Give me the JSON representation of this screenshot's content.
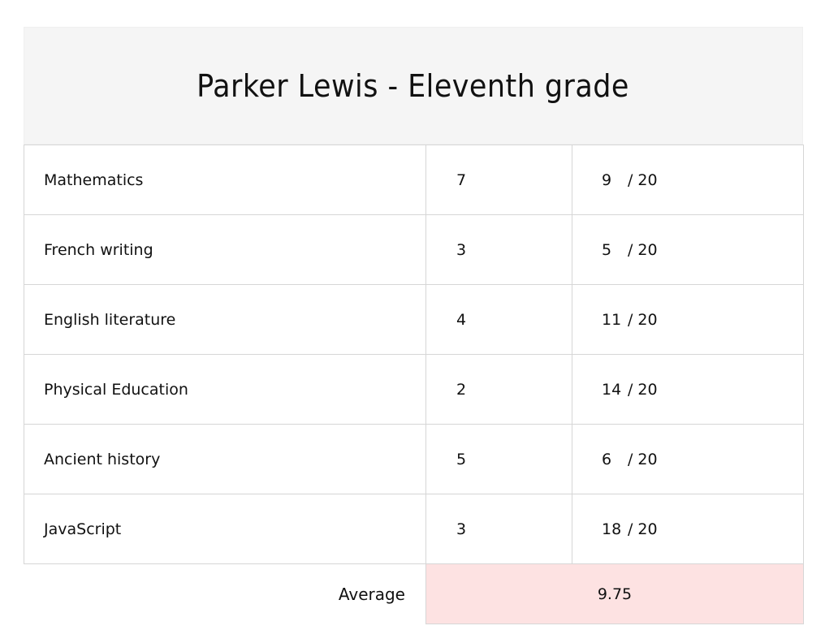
{
  "title": "Parker Lewis - Eleventh grade",
  "rows": [
    {
      "subject": "Mathematics",
      "coefficient": "7",
      "grade": "9",
      "out_of": "20"
    },
    {
      "subject": "French writing",
      "coefficient": "3",
      "grade": "5",
      "out_of": "20"
    },
    {
      "subject": "English literature",
      "coefficient": "4",
      "grade": "11",
      "out_of": "20"
    },
    {
      "subject": "Physical Education",
      "coefficient": "2",
      "grade": "14",
      "out_of": "20"
    },
    {
      "subject": "Ancient history",
      "coefficient": "5",
      "grade": "6",
      "out_of": "20"
    },
    {
      "subject": "JavaScript",
      "coefficient": "3",
      "grade": "18",
      "out_of": "20"
    }
  ],
  "average": {
    "label": "Average",
    "value": "9.75"
  },
  "colors": {
    "header_bg": "#f5f5f5",
    "average_bg": "#fde2e2",
    "border": "#d6d6d6"
  }
}
